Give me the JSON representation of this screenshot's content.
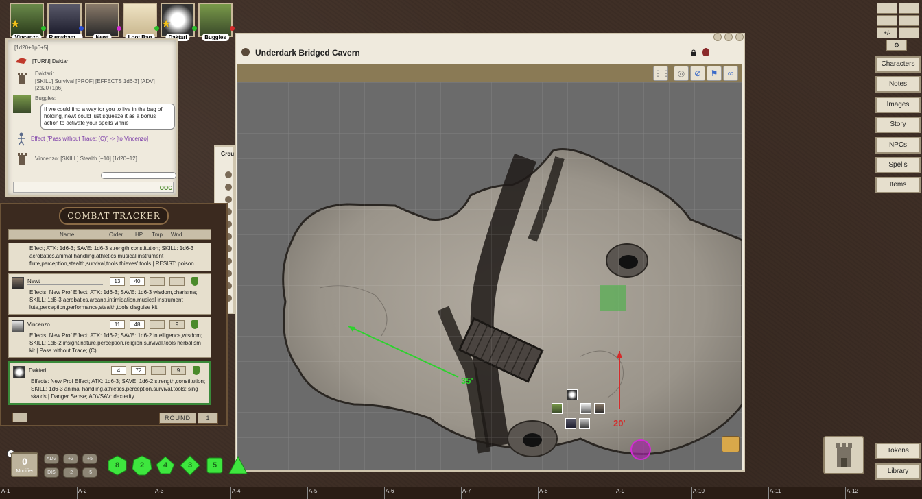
{
  "portraits": [
    {
      "name": "Vincenzo",
      "dot": "#2bbf2b",
      "star": true,
      "bg": "#4a6a3a"
    },
    {
      "name": "Ramsham...",
      "dot": "#2b4fd4",
      "star": false,
      "bg": "#3a3a4a"
    },
    {
      "name": "Newt",
      "dot": "#d42bd4",
      "star": false,
      "bg": "#5a4a3a"
    },
    {
      "name": "Loot Bag",
      "dot": "#2bbf2b",
      "star": false,
      "bg": "#d9cba8"
    },
    {
      "name": "Daktari",
      "dot": "#2bbf2b",
      "star": true,
      "bg": "#f0f0f0"
    },
    {
      "name": "Buggles",
      "dot": "#d42b2b",
      "star": false,
      "bg": "#5a7a3a"
    }
  ],
  "chat": {
    "line_top": "[1d20+1p6+5]",
    "turn": "[TURN] Daktari",
    "daktari_name": "Daktari:",
    "daktari_roll": "[SKILL] Survival [PROF] [EFFECTS 1d6-3] [ADV] [2d20+1p6]",
    "buggles_name": "Buggles:",
    "buggles_msg": "If we could find a way for you to live in the bag of holding, newt could just squeeze it as a bonus action to activate your spells vinnie",
    "effect": "Effect ['Pass without Trace; (C)'] -> [to Vincenzo]",
    "vincenzo_roll": "Vincenzo:    [SKILL] Stealth [+10] [1d20+12]",
    "ooc": "OOC"
  },
  "combat": {
    "title": "COMBAT TRACKER",
    "columns": {
      "name": "Name",
      "order": "Order",
      "hp": "HP",
      "tmp": "Tmp",
      "wnd": "Wnd"
    },
    "partial_effects": "Effect; ATK: 1d6-3; SAVE: 1d6-3 strength,constitution; SKILL: 1d6-3 acrobatics,animal handling,athletics,musical instrument flute,perception,stealth,survival,tools thieves' tools | RESIST: poison",
    "rows": [
      {
        "name": "Newt",
        "order": "13",
        "hp": "40",
        "tmp": "",
        "wnd": "",
        "effects": "Effects: New Prof Effect; ATK: 1d6-3; SAVE: 1d6-3 wisdom,charisma; SKILL: 1d6-3 acrobatics,arcana,intimidation,musical instrument lute,perception,performance,stealth,tools disguise kit"
      },
      {
        "name": "Vincenzo",
        "order": "11",
        "hp": "48",
        "tmp": "",
        "wnd": "9",
        "effects": "Effects: New Prof Effect; ATK: 1d6-2; SAVE: 1d6-2 intelligence,wisdom; SKILL: 1d6-2 insight,nature,perception,religion,survival,tools herbalism kit | Pass without Trace; (C)"
      },
      {
        "name": "Daktari",
        "order": "4",
        "hp": "72",
        "tmp": "",
        "wnd": "9",
        "effects": "Effects: New Prof Effect; ATK: 1d6-3; SAVE: 1d6-2 strength,constitution; SKILL: 1d6-3 animal handling,athletics,perception,survival,tools: sing skalds | Danger Sense; ADVSAV: dexterity"
      }
    ],
    "round_label": "ROUND",
    "round_value": "1"
  },
  "sidecol_label": "Grou",
  "map": {
    "title": "Underdark Bridged Cavern",
    "distance_green": "35'",
    "distance_red": "20'"
  },
  "sidebar": {
    "small_buttons": [
      "+/-",
      "",
      "",
      "",
      "",
      ""
    ],
    "items": [
      "Characters",
      "Notes",
      "Images",
      "Story",
      "NPCs",
      "Spells",
      "Items"
    ],
    "bottom_items": [
      "Tokens",
      "Library"
    ]
  },
  "dice": {
    "modifier_value": "0",
    "modifier_label": "Modifier",
    "mod_buttons": [
      "ADV",
      "+2",
      "+5",
      "DIS",
      "-2",
      "-5"
    ],
    "dice_labels": [
      "8",
      "2",
      "4",
      "3",
      "5",
      ""
    ]
  },
  "ruler": [
    "A-1",
    "A-2",
    "A-3",
    "A-4",
    "A-5",
    "A-6",
    "A-7",
    "A-8",
    "A-9",
    "A-10",
    "A-11",
    "A-12"
  ]
}
